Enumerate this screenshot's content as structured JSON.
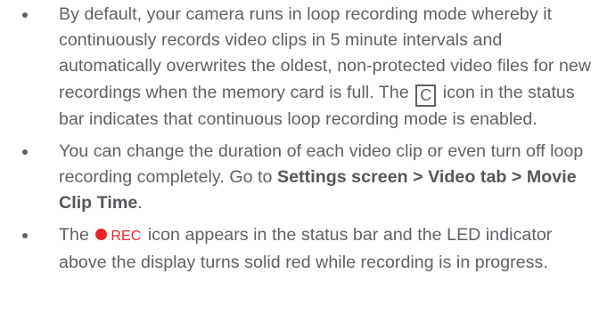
{
  "bullets": [
    {
      "before": "By default, your camera runs in loop recording mode whereby it continuously records video clips in 5 minute intervals and automatically overwrites the oldest, non-protected video files for new recordings when the memory card is full. The ",
      "icon": "C",
      "after": " icon in the status bar indicates that continuous loop recording mode is enabled."
    },
    {
      "before": "You can change the duration of each video clip or even turn off loop recording completely. Go to ",
      "path": "Settings screen > Video tab > Movie Clip Time",
      "after": "."
    },
    {
      "before": "The ",
      "icon_label": "REC",
      "after": " icon appears in the status bar and the LED indicator above the display turns solid red while recording is in progress."
    }
  ],
  "colors": {
    "text": "#5f6166",
    "rec_red": "#e8232a"
  },
  "icons": {
    "loop": "loop-recording-c-icon",
    "rec": "recording-dot-icon"
  }
}
